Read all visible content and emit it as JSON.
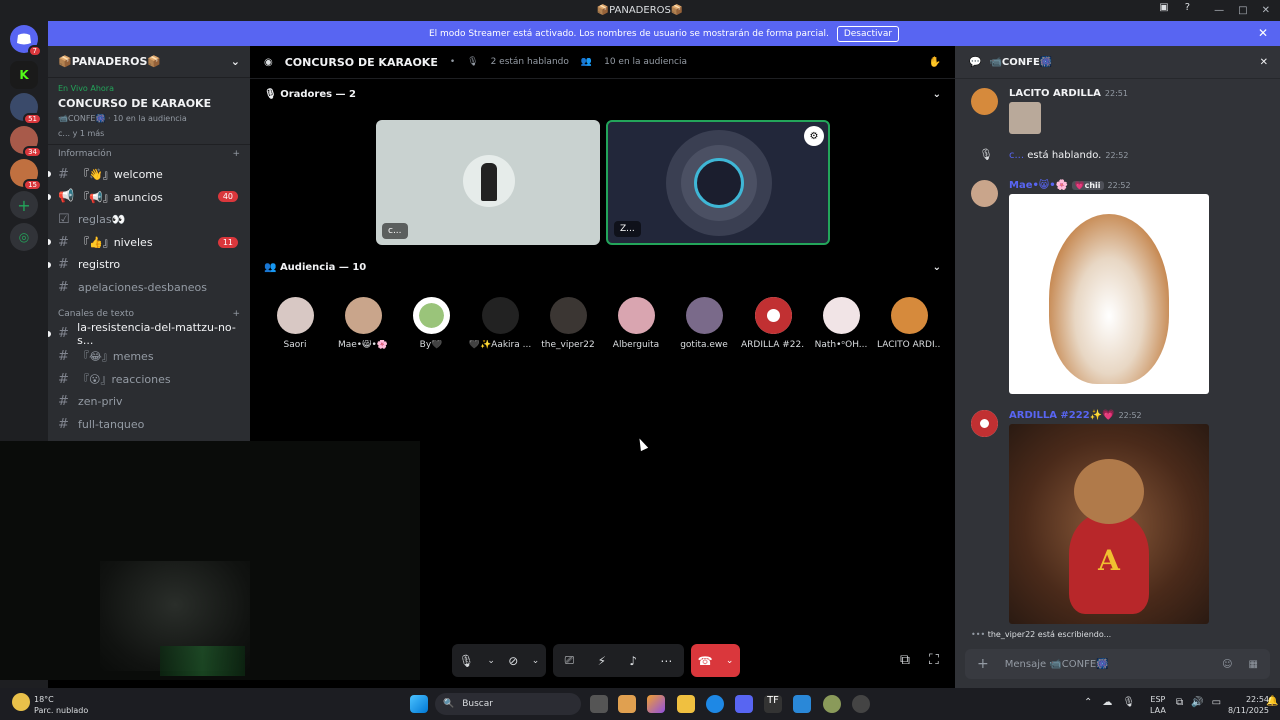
{
  "window": {
    "title": "📦PANADEROS📦"
  },
  "banner": {
    "text": "El modo Streamer está activado. Los nombres de usuario se mostrarán de forma parcial.",
    "button": "Desactivar"
  },
  "guilds": [
    {
      "badge": "7"
    },
    {
      "badge": ""
    },
    {
      "badge": "51"
    },
    {
      "badge": "34"
    },
    {
      "badge": "15"
    }
  ],
  "server": {
    "name": "📦PANADEROS📦",
    "live_label": "En Vivo Ahora",
    "live_stage": "CONCURSO DE KARAOKE",
    "live_meta_1": "📹CONFE🎆",
    "live_meta_2": "10 en la audiencia",
    "live_meta_3": "c...  y 1 más",
    "cat_info": "Información",
    "cat_text": "Canales de texto",
    "channels": [
      {
        "name": "『👋』welcome",
        "badge": ""
      },
      {
        "name": "『📢』anuncios",
        "badge": "40"
      },
      {
        "name": "reglas👀",
        "badge": ""
      },
      {
        "name": "『👍』niveles",
        "badge": "11"
      },
      {
        "name": "registro",
        "badge": ""
      },
      {
        "name": "apelaciones-desbaneos",
        "badge": ""
      }
    ],
    "text_channels": [
      {
        "name": "la-resistencia-del-mattzu-no-s..."
      },
      {
        "name": "『😂』memes"
      },
      {
        "name": "『😮』reacciones"
      },
      {
        "name": "zen-priv"
      },
      {
        "name": "full-tanqueo"
      }
    ]
  },
  "stage": {
    "title": "CONCURSO DE KARAOKE",
    "speaking": "2 están hablando",
    "audience_count": "10 en la audiencia",
    "speakers_header": "Oradores — 2",
    "audience_header": "Audiencia — 10",
    "speakers": [
      {
        "name": "c..."
      },
      {
        "name": "Z..."
      }
    ],
    "audience": [
      {
        "name": "Saori",
        "color": "#d8c8c4"
      },
      {
        "name": "Mae•😸•🌸",
        "color": "#c9a58b"
      },
      {
        "name": "By🖤",
        "color": "#9ac47a"
      },
      {
        "name": "🖤✨Aakira ...",
        "color": "#222222"
      },
      {
        "name": "the_viper22",
        "color": "#3b3633"
      },
      {
        "name": "Alberguita",
        "color": "#d9a5b0"
      },
      {
        "name": "gotita.ewe",
        "color": "#7a6a8a"
      },
      {
        "name": "ARDILLA #22...",
        "color": "#c13032"
      },
      {
        "name": "Nath•ᵒOH...",
        "color": "#f1e4e6"
      },
      {
        "name": "LACITO ARDI...",
        "color": "#d68a3c"
      }
    ]
  },
  "chat": {
    "title": "📹CONFE🎆",
    "messages": [
      {
        "author": "LACITO ARDILLA",
        "ts": "22:51"
      },
      {
        "system": "está hablando.",
        "who": "c...",
        "ts": "22:52"
      },
      {
        "author": "Mae•😸•🌸",
        "tag": "💗chii",
        "ts": "22:52"
      },
      {
        "author": "ARDILLA #222✨💗",
        "ts": "22:52"
      }
    ],
    "typing": "the_viper22 está escribiendo...",
    "placeholder": "Mensaje 📹CONFE🎆"
  },
  "taskbar": {
    "weather_temp": "18°C",
    "weather_desc": "Parc. nublado",
    "search": "Buscar",
    "lang": "ESP",
    "lang2": "LAA",
    "time": "22:54",
    "date": "8/11/2025"
  }
}
